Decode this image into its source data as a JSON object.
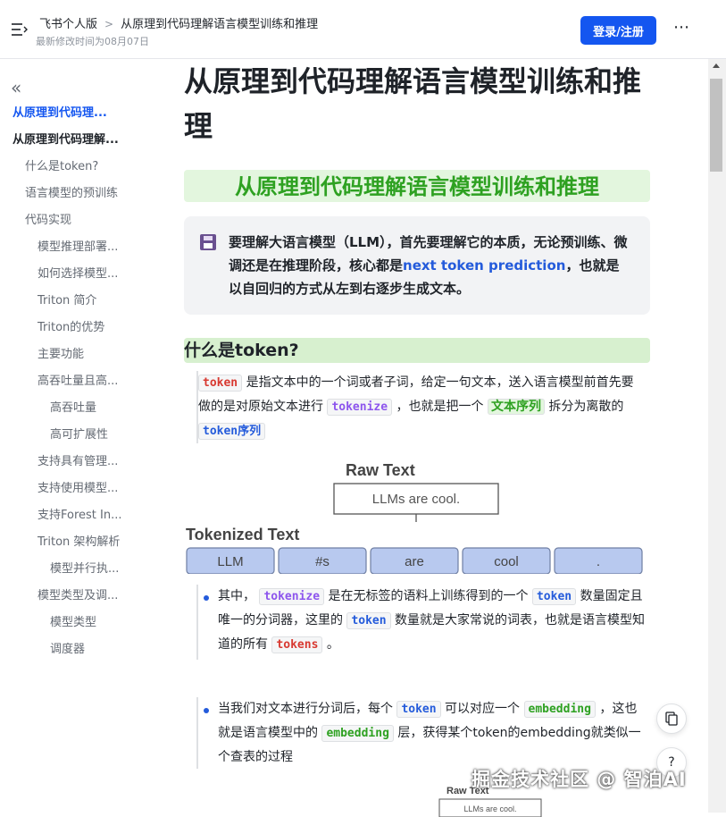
{
  "header": {
    "app_name": "飞书个人版",
    "breadcrumb_sep": ">",
    "doc_name": "从原理到代码理解语言模型训练和推理",
    "modified": "最新修改时间为08月07日",
    "login_label": "登录/注册",
    "more_label": "⋯"
  },
  "sidebar": {
    "collapse_label": "«",
    "items": [
      {
        "label": "从原理到代码理..."
      },
      {
        "label": "从原理到代码理解..."
      },
      {
        "label": "什么是token?"
      },
      {
        "label": "语言模型的预训练"
      },
      {
        "label": "代码实现"
      },
      {
        "label": "模型推理部署..."
      },
      {
        "label": "如何选择模型..."
      },
      {
        "label": "Triton 简介"
      },
      {
        "label": "Triton的优势"
      },
      {
        "label": "主要功能"
      },
      {
        "label": "高吞吐量且高..."
      },
      {
        "label": "高吞吐量"
      },
      {
        "label": "高可扩展性"
      },
      {
        "label": "支持具有管理..."
      },
      {
        "label": "支持使用模型..."
      },
      {
        "label": "支持Forest In..."
      },
      {
        "label": "Triton 架构解析"
      },
      {
        "label": "模型并行执..."
      },
      {
        "label": "模型类型及调..."
      },
      {
        "label": "模型类型"
      },
      {
        "label": "调度器"
      }
    ]
  },
  "doc": {
    "title": "从原理到代码理解语言模型训练和推理",
    "banner": "从原理到代码理解语言模型训练和推理",
    "callout": {
      "icon": "floppy-disk-icon",
      "part1": "要理解大语言模型（LLM），首先要理解它的本质，无论预训练、微调还是在推理阶段，核心都是",
      "highlight": "next token prediction",
      "part2": "，也就是以自回归的方式从左到右逐步生成文本。"
    },
    "h2": "什么是token?",
    "p1": {
      "code1": "token",
      "t1": " 是指文本中的一个词或者子词，给定一句文本，送入语言模型前首先要做的是对原始文本进行 ",
      "code2": "tokenize",
      "t2": " ，也就是把一个 ",
      "hl": "文本序列",
      "t3": " 拆分为离散的 ",
      "code3": "token序列"
    },
    "figure": {
      "raw_label": "Raw Text",
      "raw_text": "LLMs are cool.",
      "tok_label": "Tokenized Text",
      "tokens": [
        "LLM",
        "#s",
        "are",
        "cool",
        "."
      ]
    },
    "bullet1": {
      "t1": "其中， ",
      "code1": "tokenize",
      "t2": " 是在无标签的语料上训练得到的一个 ",
      "code2": "token",
      "t3": " 数量固定且唯一的分词器，这里的 ",
      "code3": "token",
      "t4": " 数量就是大家常说的词表，也就是语言模型知道的所有 ",
      "code4": "tokens",
      "t5": " 。"
    },
    "bullet2": {
      "t1": "当我们对文本进行分词后，每个 ",
      "code1": "token",
      "t2": " 可以对应一个 ",
      "code2": "embedding",
      "t3": " ，这也就是语言模型中的 ",
      "code3": "embedding",
      "t4": " 层，获得某个token的embedding就类似一个查表的过程"
    },
    "figure2": {
      "raw_label": "Raw Text",
      "raw_text": "LLMs are cool."
    }
  },
  "floaters": {
    "fab1_icon": "copy-doc-icon",
    "fab2_label": "?",
    "watermark": "掘金技术社区 @ 智泊AI"
  }
}
